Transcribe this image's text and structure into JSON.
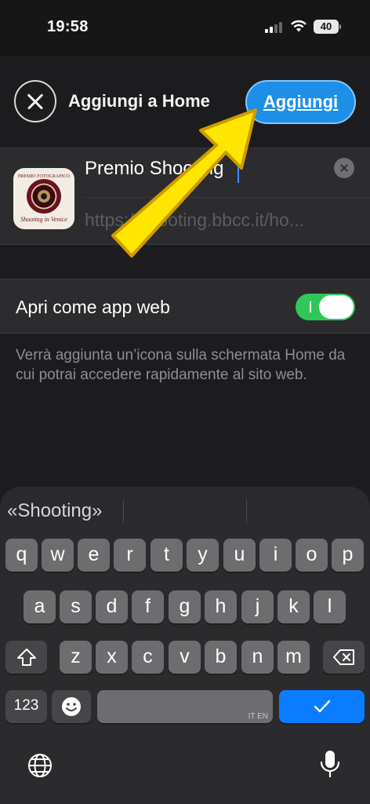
{
  "status_bar": {
    "time": "19:58",
    "battery_level": "40",
    "signal_bars": 2,
    "icons": [
      "signal-icon",
      "wifi-icon",
      "battery-icon"
    ]
  },
  "sheet": {
    "title": "Aggiungi a Home",
    "close_icon": "close-icon",
    "add_label": "Aggiungi",
    "app_icon": {
      "top_text": "PREMIO FOTOGRAFICO",
      "caption": "Shooting in Venice"
    },
    "name_value": "Premio Shooting",
    "url_value": "https://shooting.bbcc.it/ho...",
    "toggle_label": "Apri come app web",
    "toggle_on": true,
    "description": "Verrà aggiunta un’icona sulla schermata Home da cui potrai accedere rapidamente al sito web."
  },
  "keyboard": {
    "suggestion": "«Shooting»",
    "rows": [
      [
        "q",
        "w",
        "e",
        "r",
        "t",
        "y",
        "u",
        "i",
        "o",
        "p"
      ],
      [
        "a",
        "s",
        "d",
        "f",
        "g",
        "h",
        "j",
        "k",
        "l"
      ],
      [
        "z",
        "x",
        "c",
        "v",
        "b",
        "n",
        "m"
      ]
    ],
    "numbers_label": "123",
    "space_language": "IT EN",
    "icons": [
      "shift-icon",
      "delete-icon",
      "emoji-icon",
      "checkmark-icon",
      "globe-icon",
      "microphone-icon"
    ]
  },
  "colors": {
    "accent_blue": "#1d8fe6",
    "toggle_green": "#31c85a",
    "arrow_yellow": "#ffe600"
  }
}
